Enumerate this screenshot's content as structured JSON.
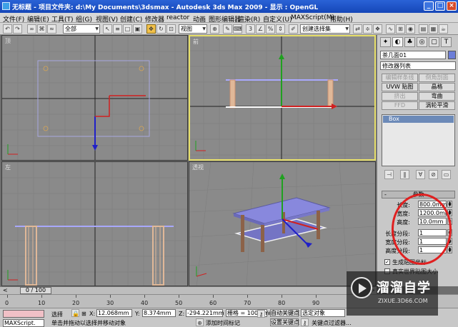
{
  "window": {
    "title": "无标题      -  项目文件夹: d:\\My Documents\\3dsmax      -  Autodesk 3ds Max   2009      -  显示 : OpenGL",
    "minimize": "_",
    "maximize": "□",
    "close": "×"
  },
  "menu": [
    "文件(F)",
    "编辑(E)",
    "工具(T)",
    "组(G)",
    "视图(V)",
    "创建(C)",
    "修改器",
    "reactor",
    "动画",
    "图形编辑器",
    "渲染(R)",
    "自定义(U)",
    "MAXScript(M)",
    "帮助(H)"
  ],
  "toolbar": {
    "selection_filter": "全部",
    "ref_coord": "视图",
    "named_selection": "创建选择集"
  },
  "viewports": {
    "top": "顶",
    "front": "前",
    "left": "左",
    "perspective": "透视"
  },
  "command_panel": {
    "object_name": "茶几面01",
    "modifier_list": "修改器列表",
    "buttons": [
      {
        "label": "编辑样条线",
        "enabled": false
      },
      {
        "label": "倒角剖面",
        "enabled": false
      },
      {
        "label": "UVW 贴图",
        "enabled": true
      },
      {
        "label": "晶格",
        "enabled": true
      },
      {
        "label": "挤出",
        "enabled": false
      },
      {
        "label": "弯曲",
        "enabled": true
      },
      {
        "label": "FFD",
        "enabled": false
      },
      {
        "label": "涡轮平滑",
        "enabled": true
      }
    ],
    "stack_item": "Box",
    "rollout_title": "参数",
    "params": [
      {
        "label": "长度:",
        "value": "800.0mm"
      },
      {
        "label": "宽度:",
        "value": "1200.0mm"
      },
      {
        "label": "高度:",
        "value": "10.0mm"
      },
      {
        "label": "长度分段:",
        "value": "1"
      },
      {
        "label": "宽度分段:",
        "value": "1"
      },
      {
        "label": "高度分段:",
        "value": "1"
      }
    ],
    "checkbox_mapping": "生成贴图坐标",
    "checkbox_realworld": "真实世界贴图大小",
    "checkbox_mapping_checked": true,
    "checkbox_realworld_checked": false
  },
  "timeline": {
    "frame": "0 / 100",
    "ticks": [
      "0",
      "10",
      "20",
      "30",
      "40",
      "50",
      "60",
      "70",
      "80",
      "90"
    ]
  },
  "status": {
    "listener": "MAXScript.",
    "selected": "选择",
    "x_label": "X:",
    "x": "12.068mm",
    "y_label": "Y:",
    "y": "8.374mm",
    "z_label": "Z:",
    "z": "-294.221mm",
    "grid": "栅格 = 100.0mm",
    "autokey": "自动关键点",
    "selected_obj": "选定对象",
    "setkey": "设置关键点",
    "keyfilter": "关键点过滤器...",
    "prompt": "单击并拖动以选择并移动对象",
    "add_time_tag": "添加时间标记"
  },
  "watermark": {
    "title": "溜溜自学",
    "url": "ZIXUE.3D66.COM"
  }
}
